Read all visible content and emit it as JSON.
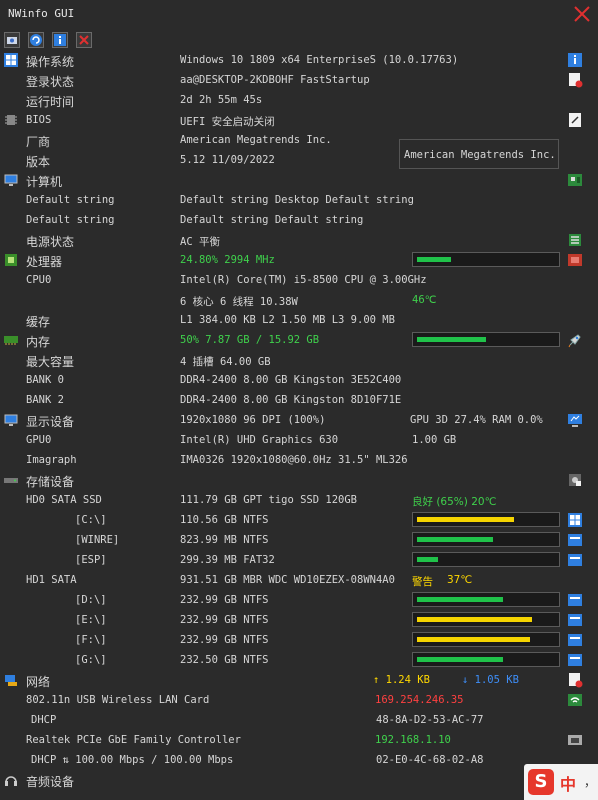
{
  "window": {
    "title": "NWinfo GUI"
  },
  "tooltip": {
    "text": "American Megatrends Inc."
  },
  "sections": {
    "os": {
      "label": "操作系统",
      "value": "Windows 10 1809 x64 EnterpriseS (10.0.17763)"
    },
    "login": {
      "label": "登录状态",
      "value": "aa@DESKTOP-2KDBOHF FastStartup"
    },
    "uptime": {
      "label": "运行时间",
      "value": "2d 2h 55m 45s"
    },
    "bios": {
      "label": "BIOS",
      "value": "UEFI 安全启动关闭"
    },
    "vendor": {
      "label": "厂商",
      "value": "American Megatrends Inc."
    },
    "version": {
      "label": "版本",
      "value": "5.12 11/09/2022"
    },
    "computer": {
      "label": "计算机"
    },
    "default1": {
      "label": "Default string",
      "value": "Default string Desktop Default string"
    },
    "default2": {
      "label": "Default string",
      "value": "Default string Default string"
    },
    "power": {
      "label": "电源状态",
      "value": "AC  平衡"
    },
    "cpu": {
      "label": "处理器",
      "value": "24.80% 2994 MHz",
      "usage": 0.248
    },
    "cpu0": {
      "label": "CPU0",
      "value": "Intel(R) Core(TM) i5-8500 CPU @ 3.00GHz"
    },
    "cores": {
      "value": "6 核心 6 线程 10.38W",
      "temp": "46℃"
    },
    "cache": {
      "label": "缓存",
      "value": "L1 384.00 KB L2 1.50 MB L3 9.00 MB"
    },
    "memory": {
      "label": "内存",
      "value": "50% 7.87 GB / 15.92 GB",
      "usage": 0.5
    },
    "maxcap": {
      "label": "最大容量",
      "value": "4 插槽 64.00 GB"
    },
    "bank0": {
      "label": "BANK 0",
      "value": "DDR4-2400 8.00 GB Kingston 3E52C400"
    },
    "bank2": {
      "label": "BANK 2",
      "value": "DDR4-2400 8.00 GB Kingston 8D10F71E"
    },
    "display": {
      "label": "显示设备",
      "value": "1920x1080 96 DPI (100%)",
      "extra": "GPU 3D 27.4% RAM 0.0%"
    },
    "gpu0": {
      "label": "GPU0",
      "value": "Intel(R) UHD Graphics 630",
      "extra": "1.00 GB"
    },
    "monitor": {
      "label": "Imagraph",
      "value": "IMA0326 1920x1080@60.0Hz 31.5\" ML326"
    },
    "storage": {
      "label": "存储设备"
    },
    "hd0": {
      "label": "HD0 SATA SSD",
      "value": "111.79 GB GPT tigo SSD 120GB",
      "status": "良好 (65%) 20℃"
    },
    "hd0_c": {
      "label": "[C:\\]",
      "value": "110.56 GB NTFS",
      "usage": 0.7,
      "color": "#f5d400"
    },
    "hd0_winre": {
      "label": "[WINRE]",
      "value": "823.99 MB NTFS",
      "usage": 0.55,
      "color": "#20c24a"
    },
    "hd0_esp": {
      "label": "[ESP]",
      "value": "299.39 MB FAT32",
      "usage": 0.15,
      "color": "#20c24a"
    },
    "hd1": {
      "label": "HD1 SATA",
      "value": "931.51 GB MBR WDC WD10EZEX-08WN4A0",
      "status_warn": "警告",
      "status_temp": "37℃"
    },
    "hd1_d": {
      "label": "[D:\\]",
      "value": "232.99 GB NTFS",
      "usage": 0.62,
      "color": "#20c24a"
    },
    "hd1_e": {
      "label": "[E:\\]",
      "value": "232.99 GB NTFS",
      "usage": 0.83,
      "color": "#f5d400"
    },
    "hd1_f": {
      "label": "[F:\\]",
      "value": "232.99 GB NTFS",
      "usage": 0.82,
      "color": "#f5d400"
    },
    "hd1_g": {
      "label": "[G:\\]",
      "value": "232.50 GB NTFS",
      "usage": 0.62,
      "color": "#20c24a"
    },
    "network": {
      "label": "网络",
      "up": "↑ 1.24 KB",
      "down": "↓ 1.05 KB"
    },
    "wlan": {
      "label": "802.11n USB Wireless LAN Card",
      "ip": "169.254.246.35"
    },
    "wlan_dhcp": {
      "label": "DHCP",
      "mac": "48-8A-D2-53-AC-77"
    },
    "eth": {
      "label": "Realtek PCIe GbE Family Controller",
      "ip": "192.168.1.10"
    },
    "eth_dhcp": {
      "label": "DHCP ⇅ 100.00 Mbps / 100.00 Mbps",
      "mac": "02-E0-4C-68-02-A8"
    },
    "audio": {
      "label": "音频设备"
    }
  },
  "ime": {
    "logo": "S",
    "lang": "中",
    "punct": "，"
  }
}
